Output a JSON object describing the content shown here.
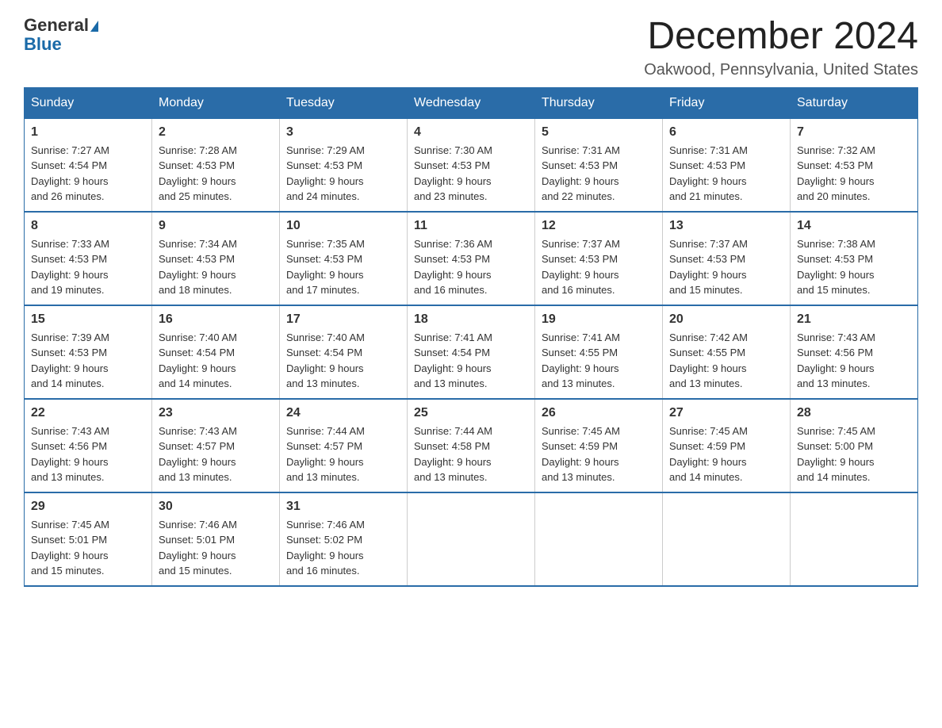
{
  "logo": {
    "general": "General",
    "blue": "Blue"
  },
  "title": "December 2024",
  "location": "Oakwood, Pennsylvania, United States",
  "headers": [
    "Sunday",
    "Monday",
    "Tuesday",
    "Wednesday",
    "Thursday",
    "Friday",
    "Saturday"
  ],
  "weeks": [
    [
      {
        "day": "1",
        "sunrise": "7:27 AM",
        "sunset": "4:54 PM",
        "daylight": "9 hours and 26 minutes."
      },
      {
        "day": "2",
        "sunrise": "7:28 AM",
        "sunset": "4:53 PM",
        "daylight": "9 hours and 25 minutes."
      },
      {
        "day": "3",
        "sunrise": "7:29 AM",
        "sunset": "4:53 PM",
        "daylight": "9 hours and 24 minutes."
      },
      {
        "day": "4",
        "sunrise": "7:30 AM",
        "sunset": "4:53 PM",
        "daylight": "9 hours and 23 minutes."
      },
      {
        "day": "5",
        "sunrise": "7:31 AM",
        "sunset": "4:53 PM",
        "daylight": "9 hours and 22 minutes."
      },
      {
        "day": "6",
        "sunrise": "7:31 AM",
        "sunset": "4:53 PM",
        "daylight": "9 hours and 21 minutes."
      },
      {
        "day": "7",
        "sunrise": "7:32 AM",
        "sunset": "4:53 PM",
        "daylight": "9 hours and 20 minutes."
      }
    ],
    [
      {
        "day": "8",
        "sunrise": "7:33 AM",
        "sunset": "4:53 PM",
        "daylight": "9 hours and 19 minutes."
      },
      {
        "day": "9",
        "sunrise": "7:34 AM",
        "sunset": "4:53 PM",
        "daylight": "9 hours and 18 minutes."
      },
      {
        "day": "10",
        "sunrise": "7:35 AM",
        "sunset": "4:53 PM",
        "daylight": "9 hours and 17 minutes."
      },
      {
        "day": "11",
        "sunrise": "7:36 AM",
        "sunset": "4:53 PM",
        "daylight": "9 hours and 16 minutes."
      },
      {
        "day": "12",
        "sunrise": "7:37 AM",
        "sunset": "4:53 PM",
        "daylight": "9 hours and 16 minutes."
      },
      {
        "day": "13",
        "sunrise": "7:37 AM",
        "sunset": "4:53 PM",
        "daylight": "9 hours and 15 minutes."
      },
      {
        "day": "14",
        "sunrise": "7:38 AM",
        "sunset": "4:53 PM",
        "daylight": "9 hours and 15 minutes."
      }
    ],
    [
      {
        "day": "15",
        "sunrise": "7:39 AM",
        "sunset": "4:53 PM",
        "daylight": "9 hours and 14 minutes."
      },
      {
        "day": "16",
        "sunrise": "7:40 AM",
        "sunset": "4:54 PM",
        "daylight": "9 hours and 14 minutes."
      },
      {
        "day": "17",
        "sunrise": "7:40 AM",
        "sunset": "4:54 PM",
        "daylight": "9 hours and 13 minutes."
      },
      {
        "day": "18",
        "sunrise": "7:41 AM",
        "sunset": "4:54 PM",
        "daylight": "9 hours and 13 minutes."
      },
      {
        "day": "19",
        "sunrise": "7:41 AM",
        "sunset": "4:55 PM",
        "daylight": "9 hours and 13 minutes."
      },
      {
        "day": "20",
        "sunrise": "7:42 AM",
        "sunset": "4:55 PM",
        "daylight": "9 hours and 13 minutes."
      },
      {
        "day": "21",
        "sunrise": "7:43 AM",
        "sunset": "4:56 PM",
        "daylight": "9 hours and 13 minutes."
      }
    ],
    [
      {
        "day": "22",
        "sunrise": "7:43 AM",
        "sunset": "4:56 PM",
        "daylight": "9 hours and 13 minutes."
      },
      {
        "day": "23",
        "sunrise": "7:43 AM",
        "sunset": "4:57 PM",
        "daylight": "9 hours and 13 minutes."
      },
      {
        "day": "24",
        "sunrise": "7:44 AM",
        "sunset": "4:57 PM",
        "daylight": "9 hours and 13 minutes."
      },
      {
        "day": "25",
        "sunrise": "7:44 AM",
        "sunset": "4:58 PM",
        "daylight": "9 hours and 13 minutes."
      },
      {
        "day": "26",
        "sunrise": "7:45 AM",
        "sunset": "4:59 PM",
        "daylight": "9 hours and 13 minutes."
      },
      {
        "day": "27",
        "sunrise": "7:45 AM",
        "sunset": "4:59 PM",
        "daylight": "9 hours and 14 minutes."
      },
      {
        "day": "28",
        "sunrise": "7:45 AM",
        "sunset": "5:00 PM",
        "daylight": "9 hours and 14 minutes."
      }
    ],
    [
      {
        "day": "29",
        "sunrise": "7:45 AM",
        "sunset": "5:01 PM",
        "daylight": "9 hours and 15 minutes."
      },
      {
        "day": "30",
        "sunrise": "7:46 AM",
        "sunset": "5:01 PM",
        "daylight": "9 hours and 15 minutes."
      },
      {
        "day": "31",
        "sunrise": "7:46 AM",
        "sunset": "5:02 PM",
        "daylight": "9 hours and 16 minutes."
      },
      null,
      null,
      null,
      null
    ]
  ],
  "labels": {
    "sunrise": "Sunrise:",
    "sunset": "Sunset:",
    "daylight": "Daylight:"
  }
}
